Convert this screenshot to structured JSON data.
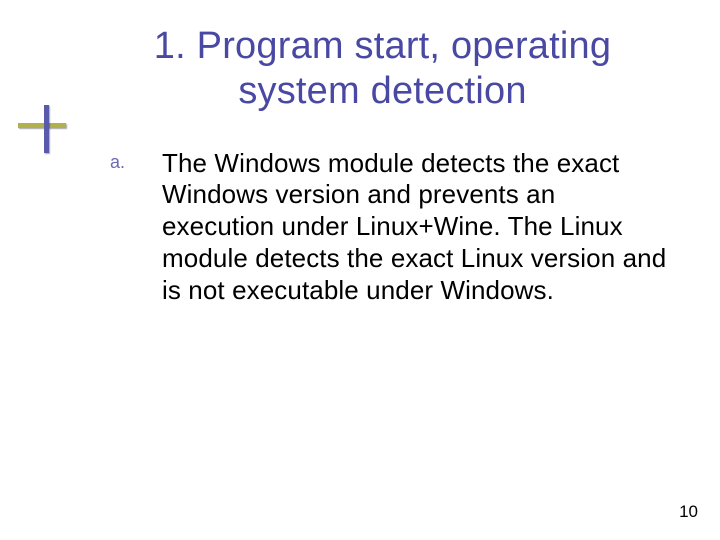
{
  "heading": {
    "number": "1.",
    "title": "Program start, operating system detection"
  },
  "body": {
    "items": [
      {
        "label": "a.",
        "text": "The Windows module detects the exact Windows version and prevents an execution under Linux+Wine. The Linux module detects the exact Linux version and is not executable under Windows."
      }
    ]
  },
  "page_number": "10",
  "colors": {
    "heading": "#4949a3",
    "bullet_label": "#6b6bb6",
    "accent_h": "#b0b04d",
    "accent_v": "#5a5aad"
  }
}
